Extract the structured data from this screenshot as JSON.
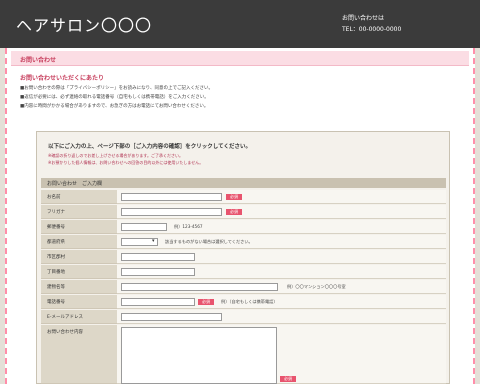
{
  "header": {
    "site_title": "ヘアサロン〇〇〇",
    "contact_label": "お問い合わせは",
    "contact_tel": "TEL：00-0000-0000"
  },
  "page": {
    "heading": "お問い合わせ"
  },
  "notice": {
    "title": "お問い合わせいただくにあたり",
    "lines": [
      "■お問い合わせの際は「プライバシーポリシー」をお読みになり、同意の上でご記入ください。",
      "■返信が必要には、必ず連絡の取れる電話番号（自宅もしくは携帯電話）をご入力ください。",
      "■内容に時間がかかる場合がありますので、お急ぎの方はお電話にてお問い合わせください。"
    ]
  },
  "form": {
    "intro": "以下にご入力の上、ページ下部の［ご入力内容の確認］をクリックしてください。",
    "notes": [
      "※確認の折り返しのでお差し上げさせる場合があります。ご了承ください。",
      "※お預かりした個人情報は、お問い合わせへの回答の目的以外には使用いたしません。"
    ],
    "table_header": "お問い合わせ　ご入力欄",
    "required_label": "必須",
    "rows": {
      "name": "お名前",
      "furigana": "フリガナ",
      "postal": "郵便番号",
      "prefecture": "都道府県",
      "city": "市区郡村",
      "street": "丁目番地",
      "building": "建物名等",
      "phone": "電話番号",
      "email": "E-メールアドレス",
      "message": "お問い合わせ内容"
    },
    "hints": {
      "postal": "例）123-4567",
      "prefecture": "該当するものがない場合は選択してください。",
      "building": "例）〇〇マンション〇〇〇号室",
      "phone": "例）（自宅もしくは携帯電話）"
    },
    "select_value": ""
  },
  "colors": {
    "header_bg": "#3b3b3b",
    "accent_pink": "#c63b5a",
    "required_bg": "#e8546e",
    "frame_dash": "#ff8eaa"
  }
}
